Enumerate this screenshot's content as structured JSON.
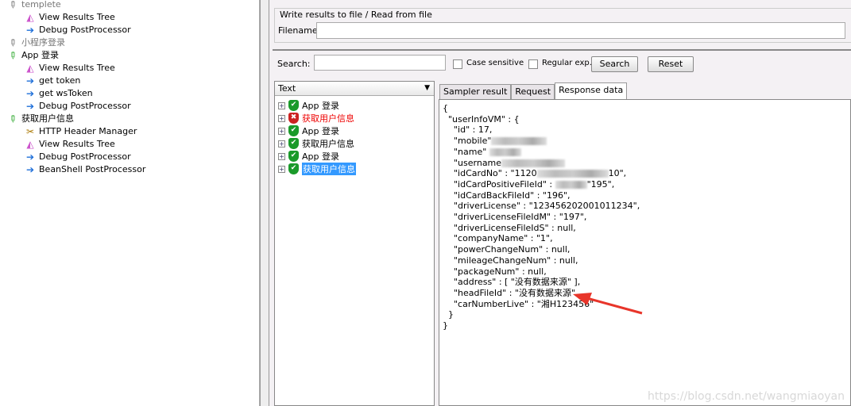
{
  "tree": [
    {
      "label": "templete",
      "indent": 0,
      "icon": "pipette-gray-icon",
      "muted": true
    },
    {
      "label": "View Results Tree",
      "indent": 1,
      "icon": "view-results-tree-icon"
    },
    {
      "label": "Debug PostProcessor",
      "indent": 1,
      "icon": "postprocessor-arrow-icon"
    },
    {
      "label": "小程序登录",
      "indent": 0,
      "icon": "pipette-gray-icon",
      "muted": true
    },
    {
      "label": "App 登录",
      "indent": 0,
      "icon": "pipette-green-icon"
    },
    {
      "label": "View Results Tree",
      "indent": 1,
      "icon": "view-results-tree-icon"
    },
    {
      "label": "get token",
      "indent": 1,
      "icon": "postprocessor-arrow-icon"
    },
    {
      "label": "get wsToken",
      "indent": 1,
      "icon": "postprocessor-arrow-icon"
    },
    {
      "label": "Debug PostProcessor",
      "indent": 1,
      "icon": "postprocessor-arrow-icon"
    },
    {
      "label": "获取用户信息",
      "indent": 0,
      "icon": "pipette-green-icon"
    },
    {
      "label": "HTTP Header Manager",
      "indent": 1,
      "icon": "wrench-icon"
    },
    {
      "label": "View Results Tree",
      "indent": 1,
      "icon": "view-results-tree-icon"
    },
    {
      "label": "Debug PostProcessor",
      "indent": 1,
      "icon": "postprocessor-arrow-icon"
    },
    {
      "label": "BeanShell PostProcessor",
      "indent": 1,
      "icon": "postprocessor-arrow-icon"
    }
  ],
  "file": {
    "legend": "Write results to file / Read from file",
    "filename_label": "Filename",
    "filename_value": ""
  },
  "search": {
    "label": "Search:",
    "value": "",
    "case_sensitive": "Case sensitive",
    "regex": "Regular exp.",
    "search_btn": "Search",
    "reset_btn": "Reset"
  },
  "renderer": {
    "selected": "Text"
  },
  "results": [
    {
      "label": "App 登录",
      "status": "success"
    },
    {
      "label": "获取用户信息",
      "status": "error"
    },
    {
      "label": "App 登录",
      "status": "success"
    },
    {
      "label": "获取用户信息",
      "status": "success"
    },
    {
      "label": "App 登录",
      "status": "success"
    },
    {
      "label": "获取用户信息",
      "status": "success",
      "selected": true
    }
  ],
  "tabs": [
    "Sampler result",
    "Request",
    "Response data"
  ],
  "active_tab": "Response data",
  "response_lines": [
    "{",
    "  \"userInfoVM\" : {",
    "    \"id\" : 17,",
    "    \"mobile\"",
    "    \"name\" ",
    "    \"username",
    "    \"idCardNo\" : \"1120",
    "    \"idCardPositiveFileId\" : ",
    "    \"idCardBackFileId\" : \"196\",",
    "    \"driverLicense\" : \"123456202001011234\",",
    "    \"driverLicenseFileIdM\" : \"197\",",
    "    \"driverLicenseFileIdS\" : null,",
    "    \"companyName\" : \"1\",",
    "    \"powerChangeNum\" : null,",
    "    \"mileageChangeNum\" : null,",
    "    \"packageNum\" : null,",
    "    \"address\" : [ \"没有数据来源\" ],",
    "    \"headFileId\" : \"没有数据来源\",",
    "    \"carNumberLive\" : \"湘H123456\"",
    "  }",
    "}"
  ],
  "response_tails": {
    "6": "10\",",
    "7": "\"195\","
  },
  "annotation_color": "#e8352a",
  "watermark": "https://blog.csdn.net/wangmiaoyan"
}
